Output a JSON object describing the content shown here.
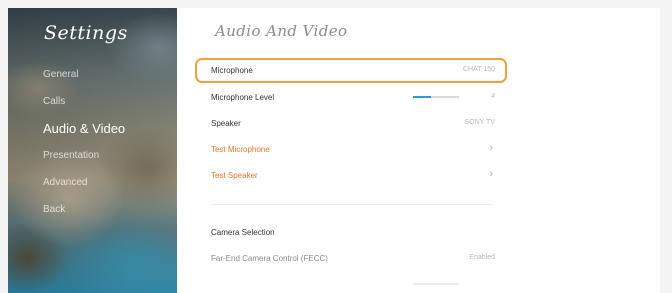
{
  "sidebar": {
    "title": "Settings",
    "items": [
      {
        "label": "General"
      },
      {
        "label": "Calls"
      },
      {
        "label": "Audio & Video"
      },
      {
        "label": "Presentation"
      },
      {
        "label": "Advanced"
      },
      {
        "label": "Back"
      }
    ]
  },
  "main": {
    "title": "Audio And Video",
    "rows": {
      "microphone": {
        "label": "Microphone",
        "value": "CHAT 150"
      },
      "microphone_level": {
        "label": "Microphone Level",
        "value": "4",
        "level_fraction": 0.4
      },
      "speaker": {
        "label": "Speaker",
        "value": "SONY TV"
      },
      "test_microphone": {
        "label": "Test Microphone"
      },
      "test_speaker": {
        "label": "Test Speaker"
      },
      "camera_selection": {
        "label": "Camera Selection"
      },
      "fecc": {
        "label": "Far-End Camera Control (FECC)",
        "value": "Enabled"
      }
    }
  },
  "colors": {
    "accent": "#e8762a",
    "focus_border": "#f0a040",
    "level_bar": "#2d9ad6"
  }
}
